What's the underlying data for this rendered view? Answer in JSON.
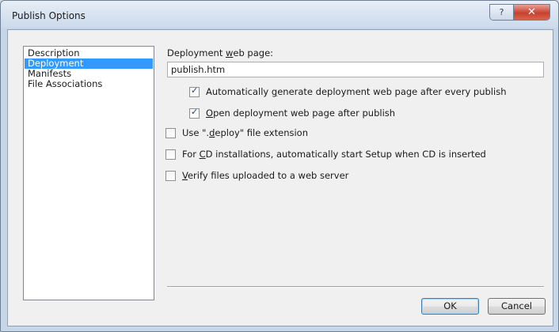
{
  "window": {
    "title": "Publish Options",
    "help_glyph": "?",
    "close_glyph": "✕"
  },
  "sidebar": {
    "items": [
      {
        "label": "Description",
        "selected": false
      },
      {
        "label": "Deployment",
        "selected": true
      },
      {
        "label": "Manifests",
        "selected": false
      },
      {
        "label": "File Associations",
        "selected": false
      }
    ]
  },
  "deployment": {
    "web_page_label_pre": "Deployment ",
    "web_page_label_u": "w",
    "web_page_label_post": "eb page:",
    "web_page_value": "publish.htm",
    "options": [
      {
        "pre": "Automatically ",
        "u": "g",
        "post": "enerate deployment web page after every publish",
        "checked": true
      },
      {
        "pre": "",
        "u": "O",
        "post": "pen deployment web page after publish",
        "checked": true
      },
      {
        "pre": "Use \".",
        "u": "d",
        "post": "eploy\" file extension",
        "checked": false
      },
      {
        "pre": "For ",
        "u": "C",
        "post": "D installations, automatically start Setup when CD is inserted",
        "checked": false
      },
      {
        "pre": "",
        "u": "V",
        "post": "erify files uploaded to a web server",
        "checked": false
      }
    ]
  },
  "buttons": {
    "ok": "OK",
    "cancel": "Cancel"
  },
  "colors": {
    "selection": "#3399ff",
    "close_button": "#c8412e"
  }
}
